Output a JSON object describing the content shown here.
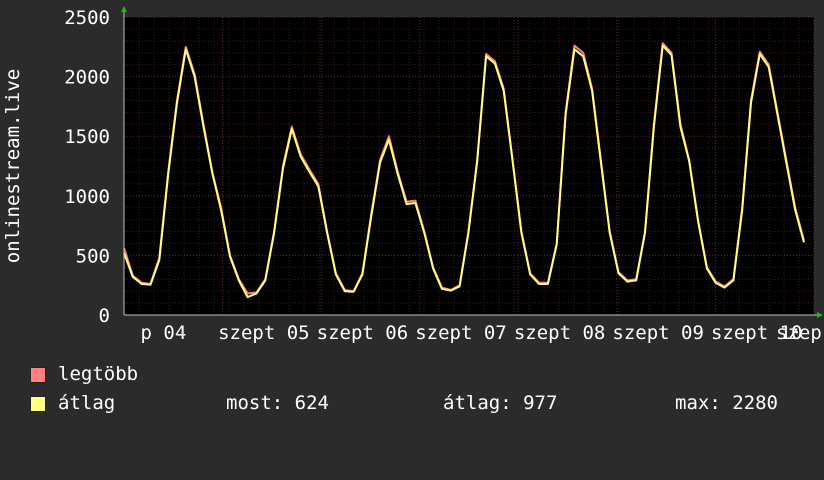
{
  "chart_data": {
    "type": "line",
    "ylabel": "onlinestream.live",
    "ylim": [
      0,
      2500
    ],
    "yticks": [
      0,
      500,
      1000,
      1500,
      2000,
      2500
    ],
    "grid": true,
    "x_tick_labels": [
      "p 04",
      "szept 05",
      "szept 06",
      "szept 07",
      "szept 08",
      "szept 09",
      "szept 10",
      "szep"
    ],
    "series": [
      {
        "name": "legtöbb",
        "color": "#ff8080",
        "values": [
          560,
          330,
          270,
          260,
          480,
          1200,
          1800,
          2250,
          2020,
          1600,
          1200,
          900,
          500,
          300,
          180,
          190,
          300,
          700,
          1250,
          1580,
          1350,
          1220,
          1100,
          700,
          350,
          210,
          200,
          350,
          850,
          1300,
          1500,
          1200,
          950,
          960,
          700,
          400,
          230,
          210,
          250,
          700,
          1300,
          2190,
          2130,
          1900,
          1300,
          700,
          350,
          270,
          270,
          600,
          1700,
          2260,
          2200,
          1900,
          1300,
          700,
          360,
          290,
          300,
          700,
          1600,
          2280,
          2200,
          1600,
          1300,
          800,
          400,
          280,
          240,
          300,
          900,
          1800,
          2210,
          2100,
          1700,
          1300,
          900,
          624
        ]
      },
      {
        "name": "átlag",
        "color": "#ffff80",
        "values": [
          520,
          320,
          260,
          255,
          460,
          1180,
          1780,
          2230,
          2000,
          1580,
          1190,
          880,
          490,
          290,
          150,
          180,
          290,
          690,
          1230,
          1560,
          1330,
          1200,
          1080,
          690,
          340,
          200,
          195,
          340,
          830,
          1280,
          1470,
          1180,
          930,
          940,
          690,
          390,
          220,
          205,
          240,
          690,
          1290,
          2170,
          2110,
          1880,
          1290,
          690,
          340,
          260,
          260,
          590,
          1680,
          2230,
          2170,
          1880,
          1280,
          690,
          350,
          280,
          290,
          690,
          1580,
          2260,
          2180,
          1580,
          1290,
          790,
          390,
          270,
          230,
          290,
          880,
          1780,
          2190,
          2080,
          1680,
          1280,
          880,
          610
        ]
      }
    ],
    "legend_position": "bottom-left"
  },
  "stats": {
    "now": "most: 624",
    "avg": "átlag: 977",
    "max": "max: 2280"
  }
}
